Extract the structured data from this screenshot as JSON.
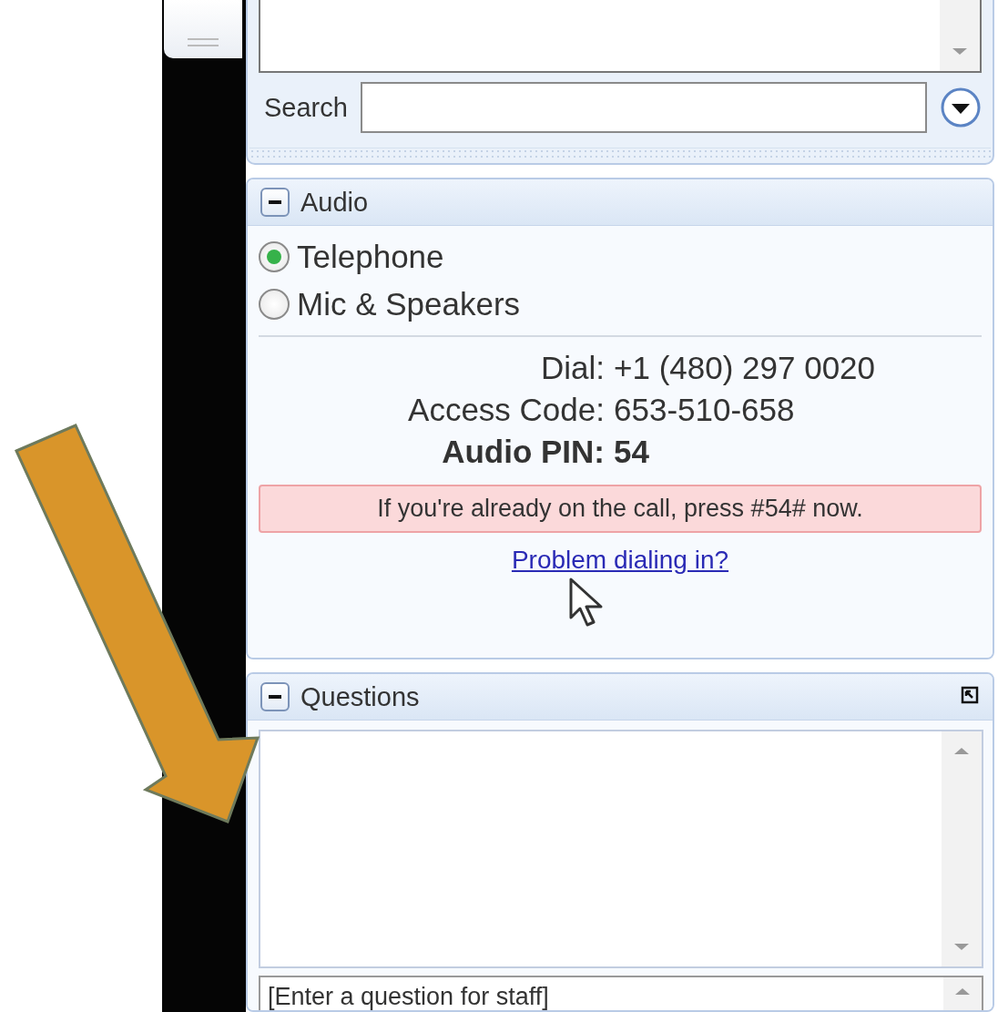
{
  "search": {
    "label": "Search"
  },
  "audio": {
    "title": "Audio",
    "expanded": true,
    "options": [
      {
        "label": "Telephone",
        "selected": true
      },
      {
        "label": "Mic & Speakers",
        "selected": false
      }
    ],
    "details": [
      {
        "kind": "plain",
        "label": "Dial:",
        "value": "+1 (480) 297 0020"
      },
      {
        "kind": "plain",
        "label": "Access Code:",
        "value": "653-510-658"
      },
      {
        "kind": "strong",
        "label": "Audio PIN:",
        "value": "54"
      }
    ],
    "notice": "If you're already on the call, press #54# now.",
    "help_link": "Problem dialing in?"
  },
  "questions": {
    "title": "Questions",
    "expanded": true,
    "input": {
      "placeholder": "[Enter a question for staff]"
    }
  }
}
